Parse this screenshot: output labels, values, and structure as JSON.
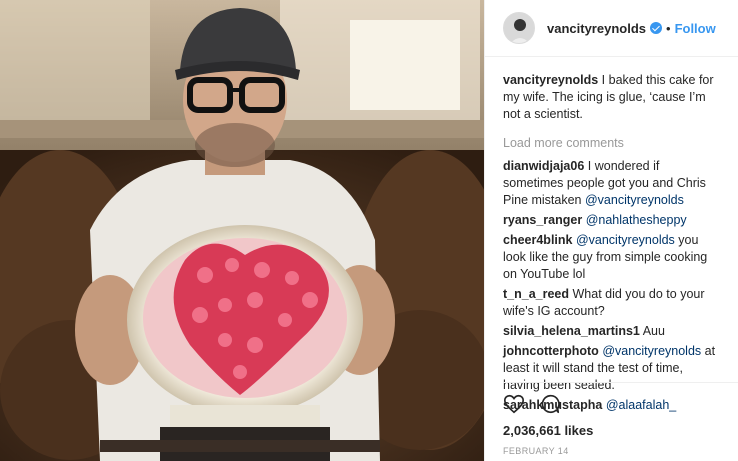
{
  "post": {
    "username": "vancityreynolds",
    "follow_label": "Follow",
    "dot": "•",
    "caption_text": "I baked this cake for my wife. The icing is glue, ‘cause I’m not a scientist.",
    "load_more": "Load more comments",
    "comments": [
      {
        "user": "dianwidjaja06",
        "text_before": "I wondered if sometimes people got you and Chris Pine mistaken ",
        "mention": "@vancityreynolds",
        "text_after": ""
      },
      {
        "user": "ryans_ranger",
        "text_before": "",
        "mention": "@nahlathesheppy",
        "text_after": ""
      },
      {
        "user": "cheer4blink",
        "text_before": "",
        "mention": "@vancityreynolds",
        "text_after": " you look like the guy from simple cooking on YouTube lol"
      },
      {
        "user": "t_n_a_reed",
        "text_before": "What did you do to your wife's IG account?",
        "mention": "",
        "text_after": ""
      },
      {
        "user": "silvia_helena_martins1",
        "text_before": "Auu",
        "mention": "",
        "text_after": ""
      },
      {
        "user": "johncotterphoto",
        "text_before": "",
        "mention": "@vancityreynolds",
        "text_after": " at least it will stand the test of time, having been sealed."
      },
      {
        "user": "sarahkmustapha",
        "text_before": "",
        "mention": "@alaafalah_",
        "text_after": ""
      }
    ],
    "likes": "2,036,661 likes",
    "date": "FEBRUARY 14"
  },
  "icons": {
    "like": "heart-outline-icon",
    "comment": "speech-bubble-icon",
    "verified": "verified-badge-icon"
  },
  "colors": {
    "accent": "#3897f0",
    "mention": "#003569",
    "muted": "#999999",
    "text": "#262626"
  }
}
